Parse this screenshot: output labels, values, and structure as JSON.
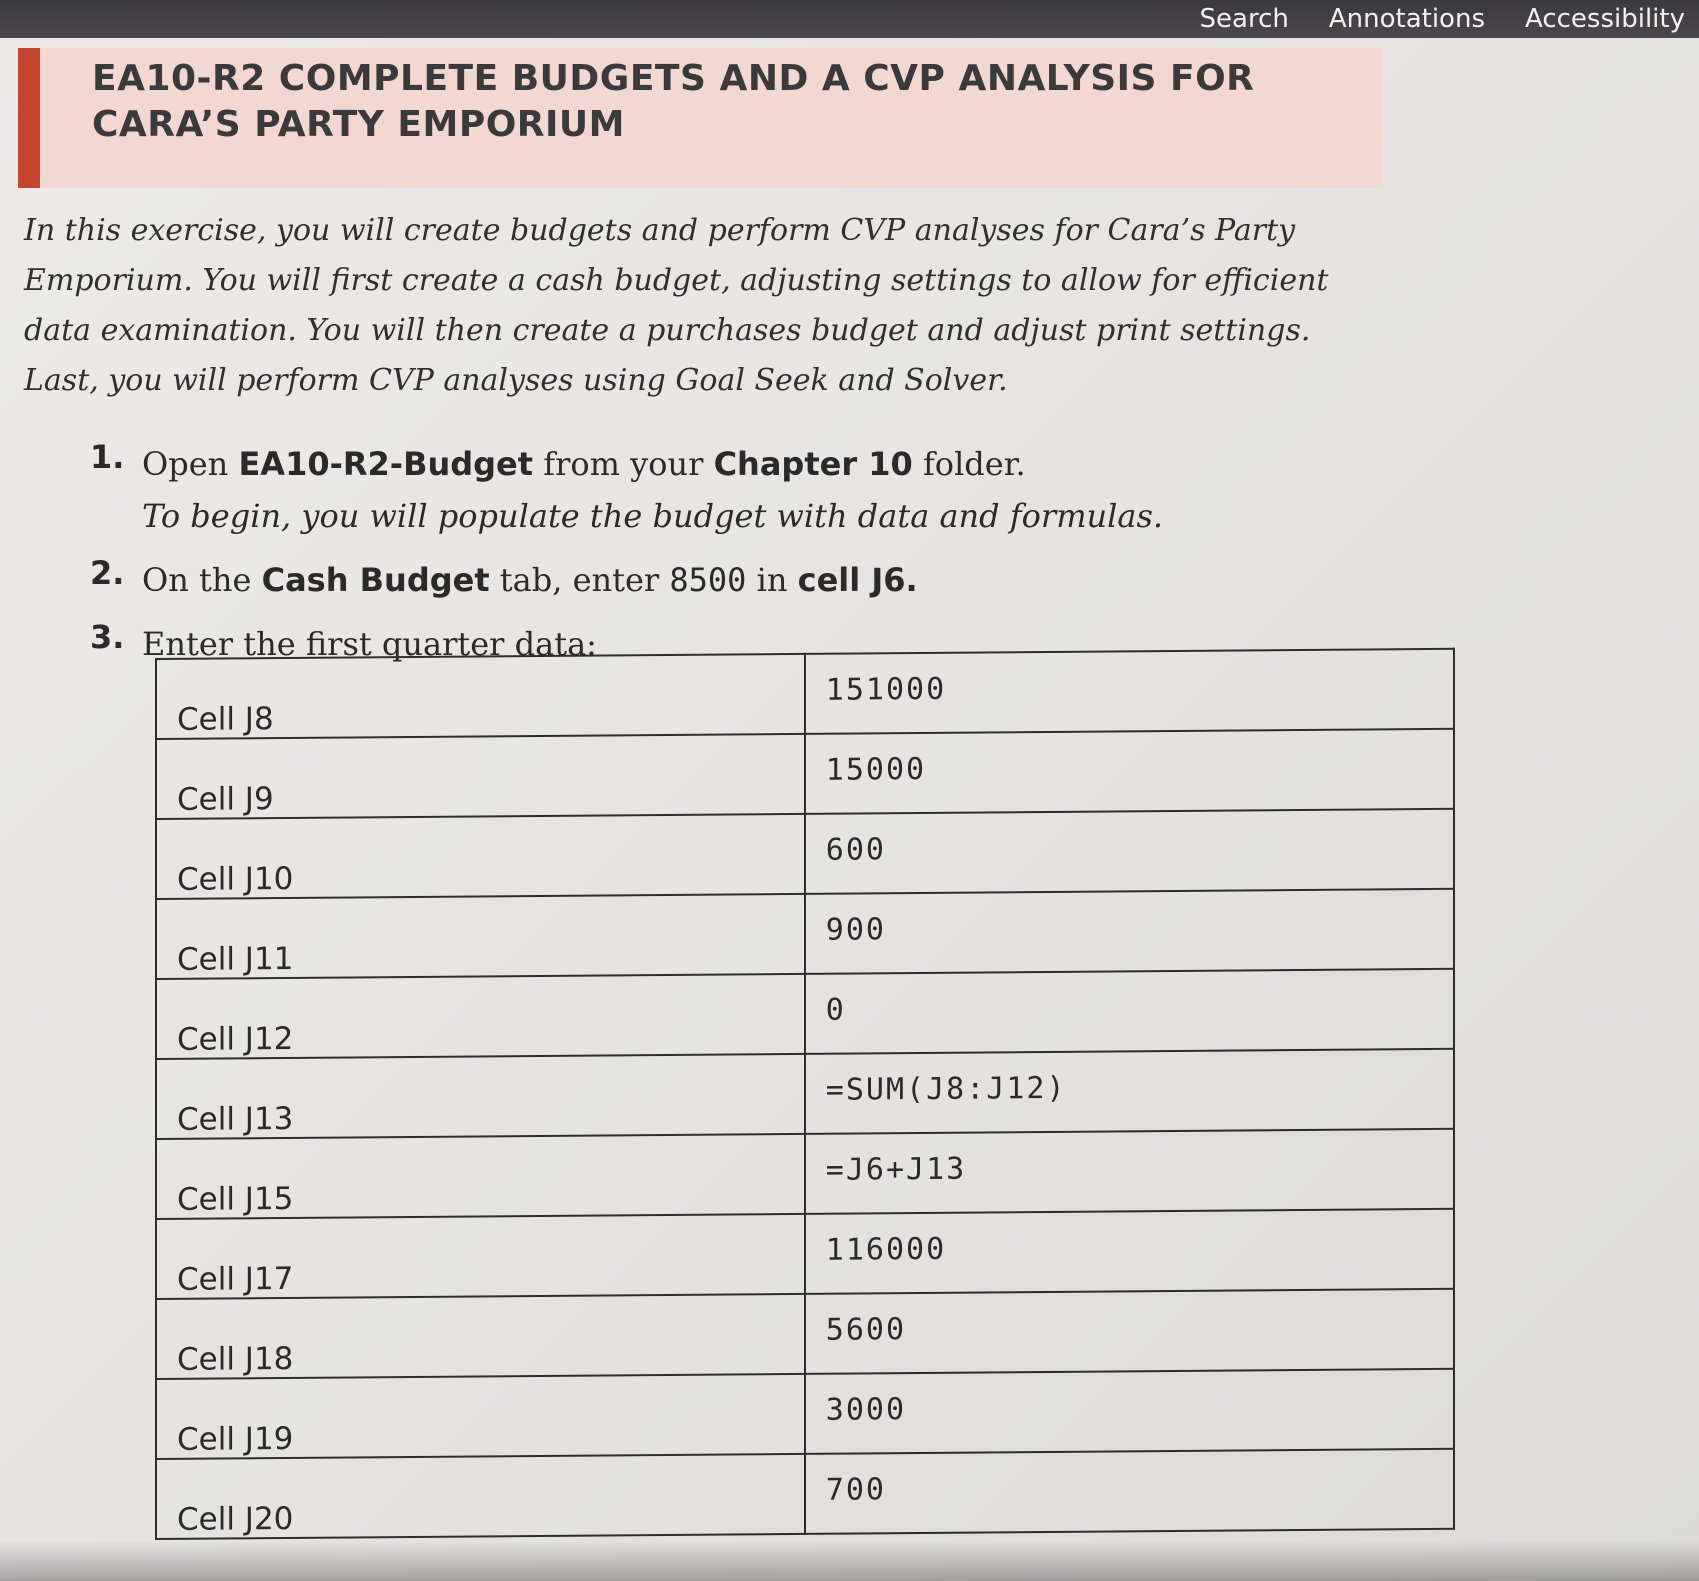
{
  "nav": {
    "search": "Search",
    "annotations": "Annotations",
    "accessibility": "Accessibility"
  },
  "title": "EA10-R2 COMPLETE BUDGETS AND A CVP ANALYSIS FOR CARA’S PARTY EMPORIUM",
  "intro": "In this exercise, you will create budgets and perform CVP analyses for Cara’s Party Emporium. You will first create a cash budget, adjusting settings to allow for efficient data examination. You will then create a purchases budget and adjust print settings. Last, you will perform CVP analyses using Goal Seek and Solver.",
  "steps": [
    {
      "number": "1.",
      "open": "Open",
      "file": "EA10-R2-Budget",
      "from": "from your",
      "folder_name": "Chapter 10",
      "folder": "folder.",
      "sub": "To begin, you will populate the budget with data and formulas."
    },
    {
      "number": "2.",
      "on_the": "On the",
      "tab_name": "Cash Budget",
      "tab_enter": "tab, enter",
      "value": "8500",
      "in": "in",
      "cell": "cell J6."
    },
    {
      "number": "3.",
      "text": "Enter the first quarter data:"
    }
  ],
  "table": {
    "rows": [
      {
        "cell": "Cell J8",
        "value": "151000"
      },
      {
        "cell": "Cell J9",
        "value": "15000"
      },
      {
        "cell": "Cell J10",
        "value": "600"
      },
      {
        "cell": "Cell J11",
        "value": "900"
      },
      {
        "cell": "Cell J12",
        "value": "0"
      },
      {
        "cell": "Cell J13",
        "value": "=SUM(J8:J12)"
      },
      {
        "cell": "Cell J15",
        "value": "=J6+J13"
      },
      {
        "cell": "Cell J17",
        "value": "116000"
      },
      {
        "cell": "Cell J18",
        "value": "5600"
      },
      {
        "cell": "Cell J19",
        "value": "3000"
      },
      {
        "cell": "Cell J20",
        "value": "700"
      }
    ]
  }
}
